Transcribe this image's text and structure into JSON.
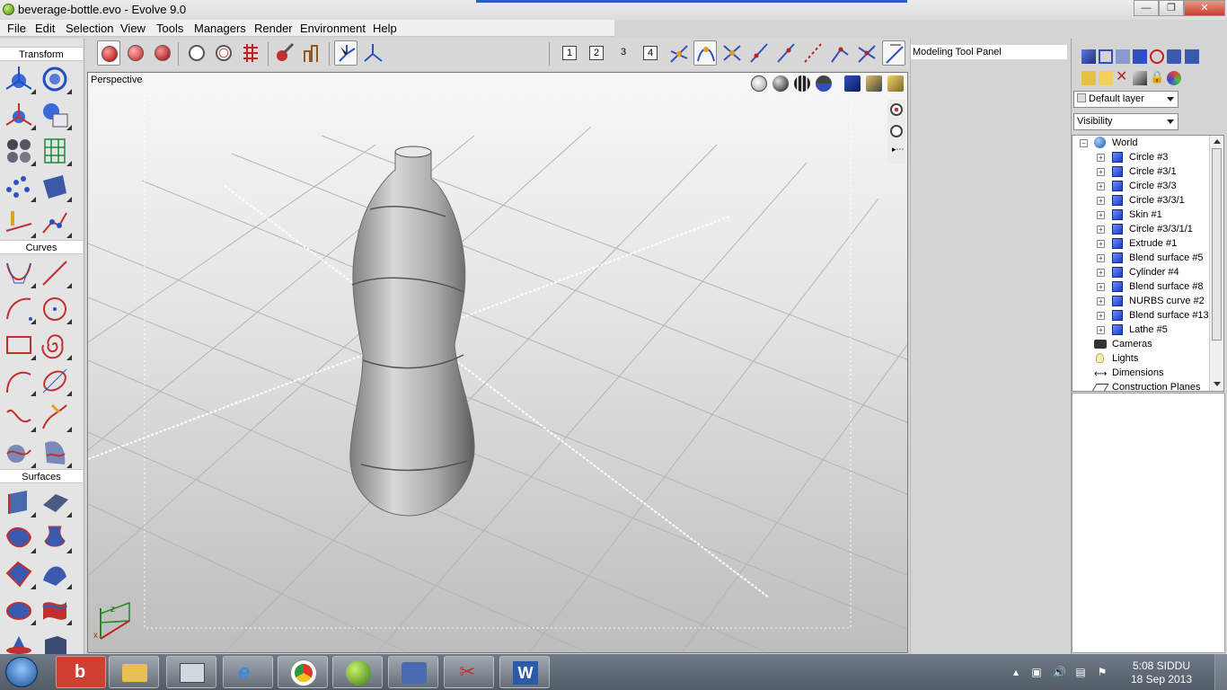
{
  "window": {
    "title": "beverage-bottle.evo - Evolve 9.0",
    "min_label": "—",
    "max_label": "❐",
    "close_label": "✕"
  },
  "menu": [
    "File",
    "Edit",
    "Selection",
    "View",
    "Tools",
    "Managers",
    "Render",
    "Environment",
    "Help"
  ],
  "left_panel": {
    "sections": [
      "Transform",
      "Curves",
      "Surfaces"
    ]
  },
  "toolbar": {
    "view_numbers": [
      "1",
      "2",
      "3",
      "4"
    ]
  },
  "viewport": {
    "label": "Perspective",
    "axis_x": "x",
    "axis_z": "z"
  },
  "tool_panel": {
    "title": "Modeling Tool Panel"
  },
  "scene": {
    "layer_dropdown": "Default layer",
    "filter_dropdown": "Visibility",
    "root": "World",
    "objects": [
      "Circle #3",
      "Circle #3/1",
      "Circle #3/3",
      "Circle #3/3/1",
      "Skin #1",
      "Circle #3/3/1/1",
      "Extrude #1",
      "Blend surface #5",
      "Cylinder #4",
      "Blend surface #8",
      "NURBS curve #2",
      "Blend surface #13",
      "Lathe #5"
    ],
    "groups": [
      "Cameras",
      "Lights",
      "Dimensions",
      "Construction Planes"
    ]
  },
  "taskbar": {
    "time": "5:08",
    "user": "SIDDU",
    "date": "18 Sep 2013",
    "apps": [
      "bing-app",
      "file-explorer",
      "control-panel",
      "internet-explorer",
      "chrome",
      "evolve",
      "network",
      "snipping-tool",
      "word"
    ]
  },
  "colors": {
    "accent": "#2a5fc8",
    "taskbar": "#5e6872",
    "viewport_bg": "#d8d8d8"
  }
}
